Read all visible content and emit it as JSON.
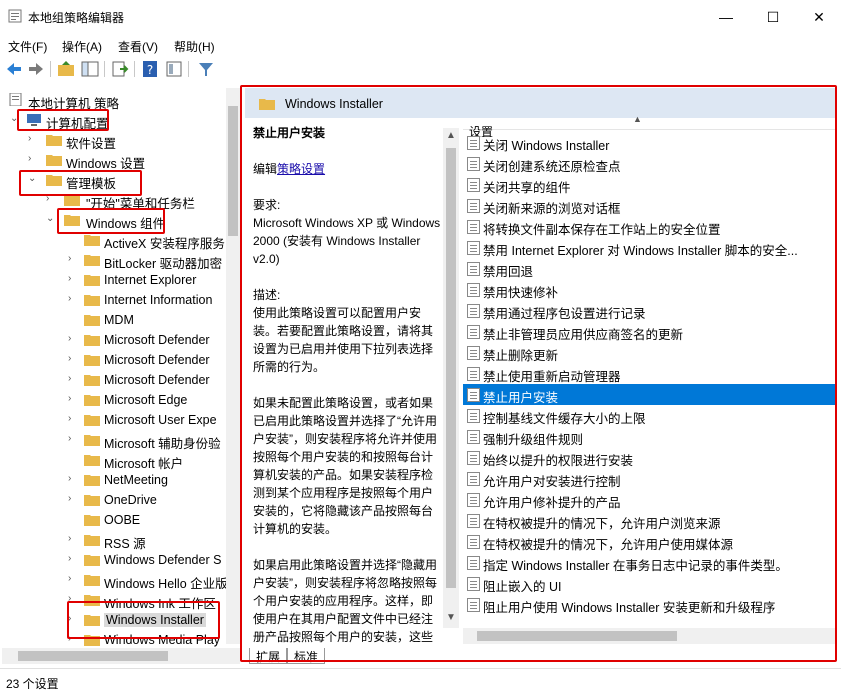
{
  "window": {
    "title": "本地组策略编辑器",
    "controls": {
      "minimize": "—",
      "maximize": "☐",
      "close": "✕"
    }
  },
  "menu": [
    "文件(F)",
    "操作(A)",
    "查看(V)",
    "帮助(H)"
  ],
  "toolbar_icons": [
    "back-icon",
    "forward-icon",
    "up-folder-icon",
    "show-hide-tree-icon",
    "export-list-icon",
    "help-icon",
    "view-icon",
    "filter-icon"
  ],
  "tree": {
    "root": "本地计算机 策略",
    "computer_config": "计算机配置",
    "software_settings": "软件设置",
    "windows_settings": "Windows 设置",
    "admin_templates": "管理模板",
    "start_menu": "\"开始\"菜单和任务栏",
    "windows_components": "Windows 组件",
    "items": [
      "ActiveX 安装程序服务",
      "BitLocker 驱动器加密",
      "Internet Explorer",
      "Internet Information",
      "MDM",
      "Microsoft Defender",
      "Microsoft Defender",
      "Microsoft Defender",
      "Microsoft Edge",
      "Microsoft User Expe",
      "Microsoft 辅助身份验",
      "Microsoft 帐户",
      "NetMeeting",
      "OneDrive",
      "OOBE",
      "RSS 源",
      "Windows Defender S",
      "Windows Hello 企业版",
      "Windows Ink 工作区",
      "Windows Installer",
      "Windows Media Play"
    ]
  },
  "right": {
    "header_title": "Windows Installer",
    "desc": {
      "title": "禁止用户安装",
      "edit_prefix": "编辑",
      "edit_link": "策略设置",
      "req_label": "要求:",
      "req_text": "Microsoft Windows XP 或 Windows 2000 (安装有 Windows Installer v2.0)",
      "desc_label": "描述:",
      "p1": "使用此策略设置可以配置用户安装。若要配置此策略设置，请将其设置为已启用并使用下拉列表选择所需的行为。",
      "p2": "如果未配置此策略设置，或者如果已启用此策略设置并选择了“允许用户安装”，则安装程序将允许并使用按照每个用户安装的和按照每台计算机安装的产品。如果安装程序检测到某个应用程序是按照每个用户安装的，它将隐藏该产品按照每台计算机的安装。",
      "p3": "如果启用此策略设置并选择“隐藏用户安装”，则安装程序将忽略按照每个用户安装的应用程序。这样，即使用户在其用户配置文件中已经注册产品按照每个用户的安装，这些用户仍将会看到按照每台计算机安装的应用程序。"
    },
    "list_header": "设置",
    "settings": [
      "关闭 Windows Installer",
      "关闭创建系统还原检查点",
      "关闭共享的组件",
      "关闭新来源的浏览对话框",
      "将转换文件副本保存在工作站上的安全位置",
      "禁用 Internet Explorer 对 Windows Installer 脚本的安全...",
      "禁用回退",
      "禁用快速修补",
      "禁用通过程序包设置进行记录",
      "禁止非管理员应用供应商签名的更新",
      "禁止删除更新",
      "禁止使用重新启动管理器",
      "禁止用户安装",
      "控制基线文件缓存大小的上限",
      "强制升级组件规则",
      "始终以提升的权限进行安装",
      "允许用户对安装进行控制",
      "允许用户修补提升的产品",
      "在特权被提升的情况下，允许用户浏览来源",
      "在特权被提升的情况下，允许用户使用媒体源",
      "指定 Windows Installer 在事务日志中记录的事件类型。",
      "阻止嵌入的 UI",
      "阻止用户使用 Windows Installer 安装更新和升级程序"
    ],
    "selected_index": 12,
    "tabs": [
      "扩展",
      "标准"
    ]
  },
  "status": "23 个设置",
  "colors": {
    "selection": "#0078d7",
    "header_bg": "#dde7f3",
    "annotation": "#e00000",
    "folder": "#e8b94a"
  }
}
